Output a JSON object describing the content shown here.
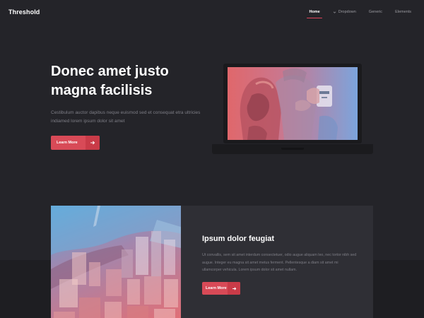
{
  "header": {
    "brand": "Threshold",
    "nav": [
      {
        "label": "Home",
        "active": true
      },
      {
        "label": "Dropdown",
        "has_chevron": true
      },
      {
        "label": "Generic"
      },
      {
        "label": "Elements"
      }
    ]
  },
  "hero": {
    "title": "Donec amet justo magna facilisis",
    "text": "Cestibulum auctor dapibus neque euismod sed et consequat etra ultricies indiamed lorem ipsum dolor sit amet",
    "button_label": "Learn More"
  },
  "feature": {
    "title": "Ipsum dolor feugiat",
    "text": "Ut convallis, sem sit amet interdum consectetuer, odio augue aliquam leo, nec tortor nibh sed augue. Integer eu magna sit amet metus ferment. Pellentesque a diam sit amet mi ullamcorper vehicula. Lorem ipsum dolor sit amet nullam.",
    "button_label": "Learn More"
  },
  "colors": {
    "background": "#242429",
    "accent": "#d84a57",
    "card": "#2f2f35"
  },
  "icons": {
    "button_arrow": "arrow-right-icon",
    "dropdown": "chevron-down-icon"
  }
}
